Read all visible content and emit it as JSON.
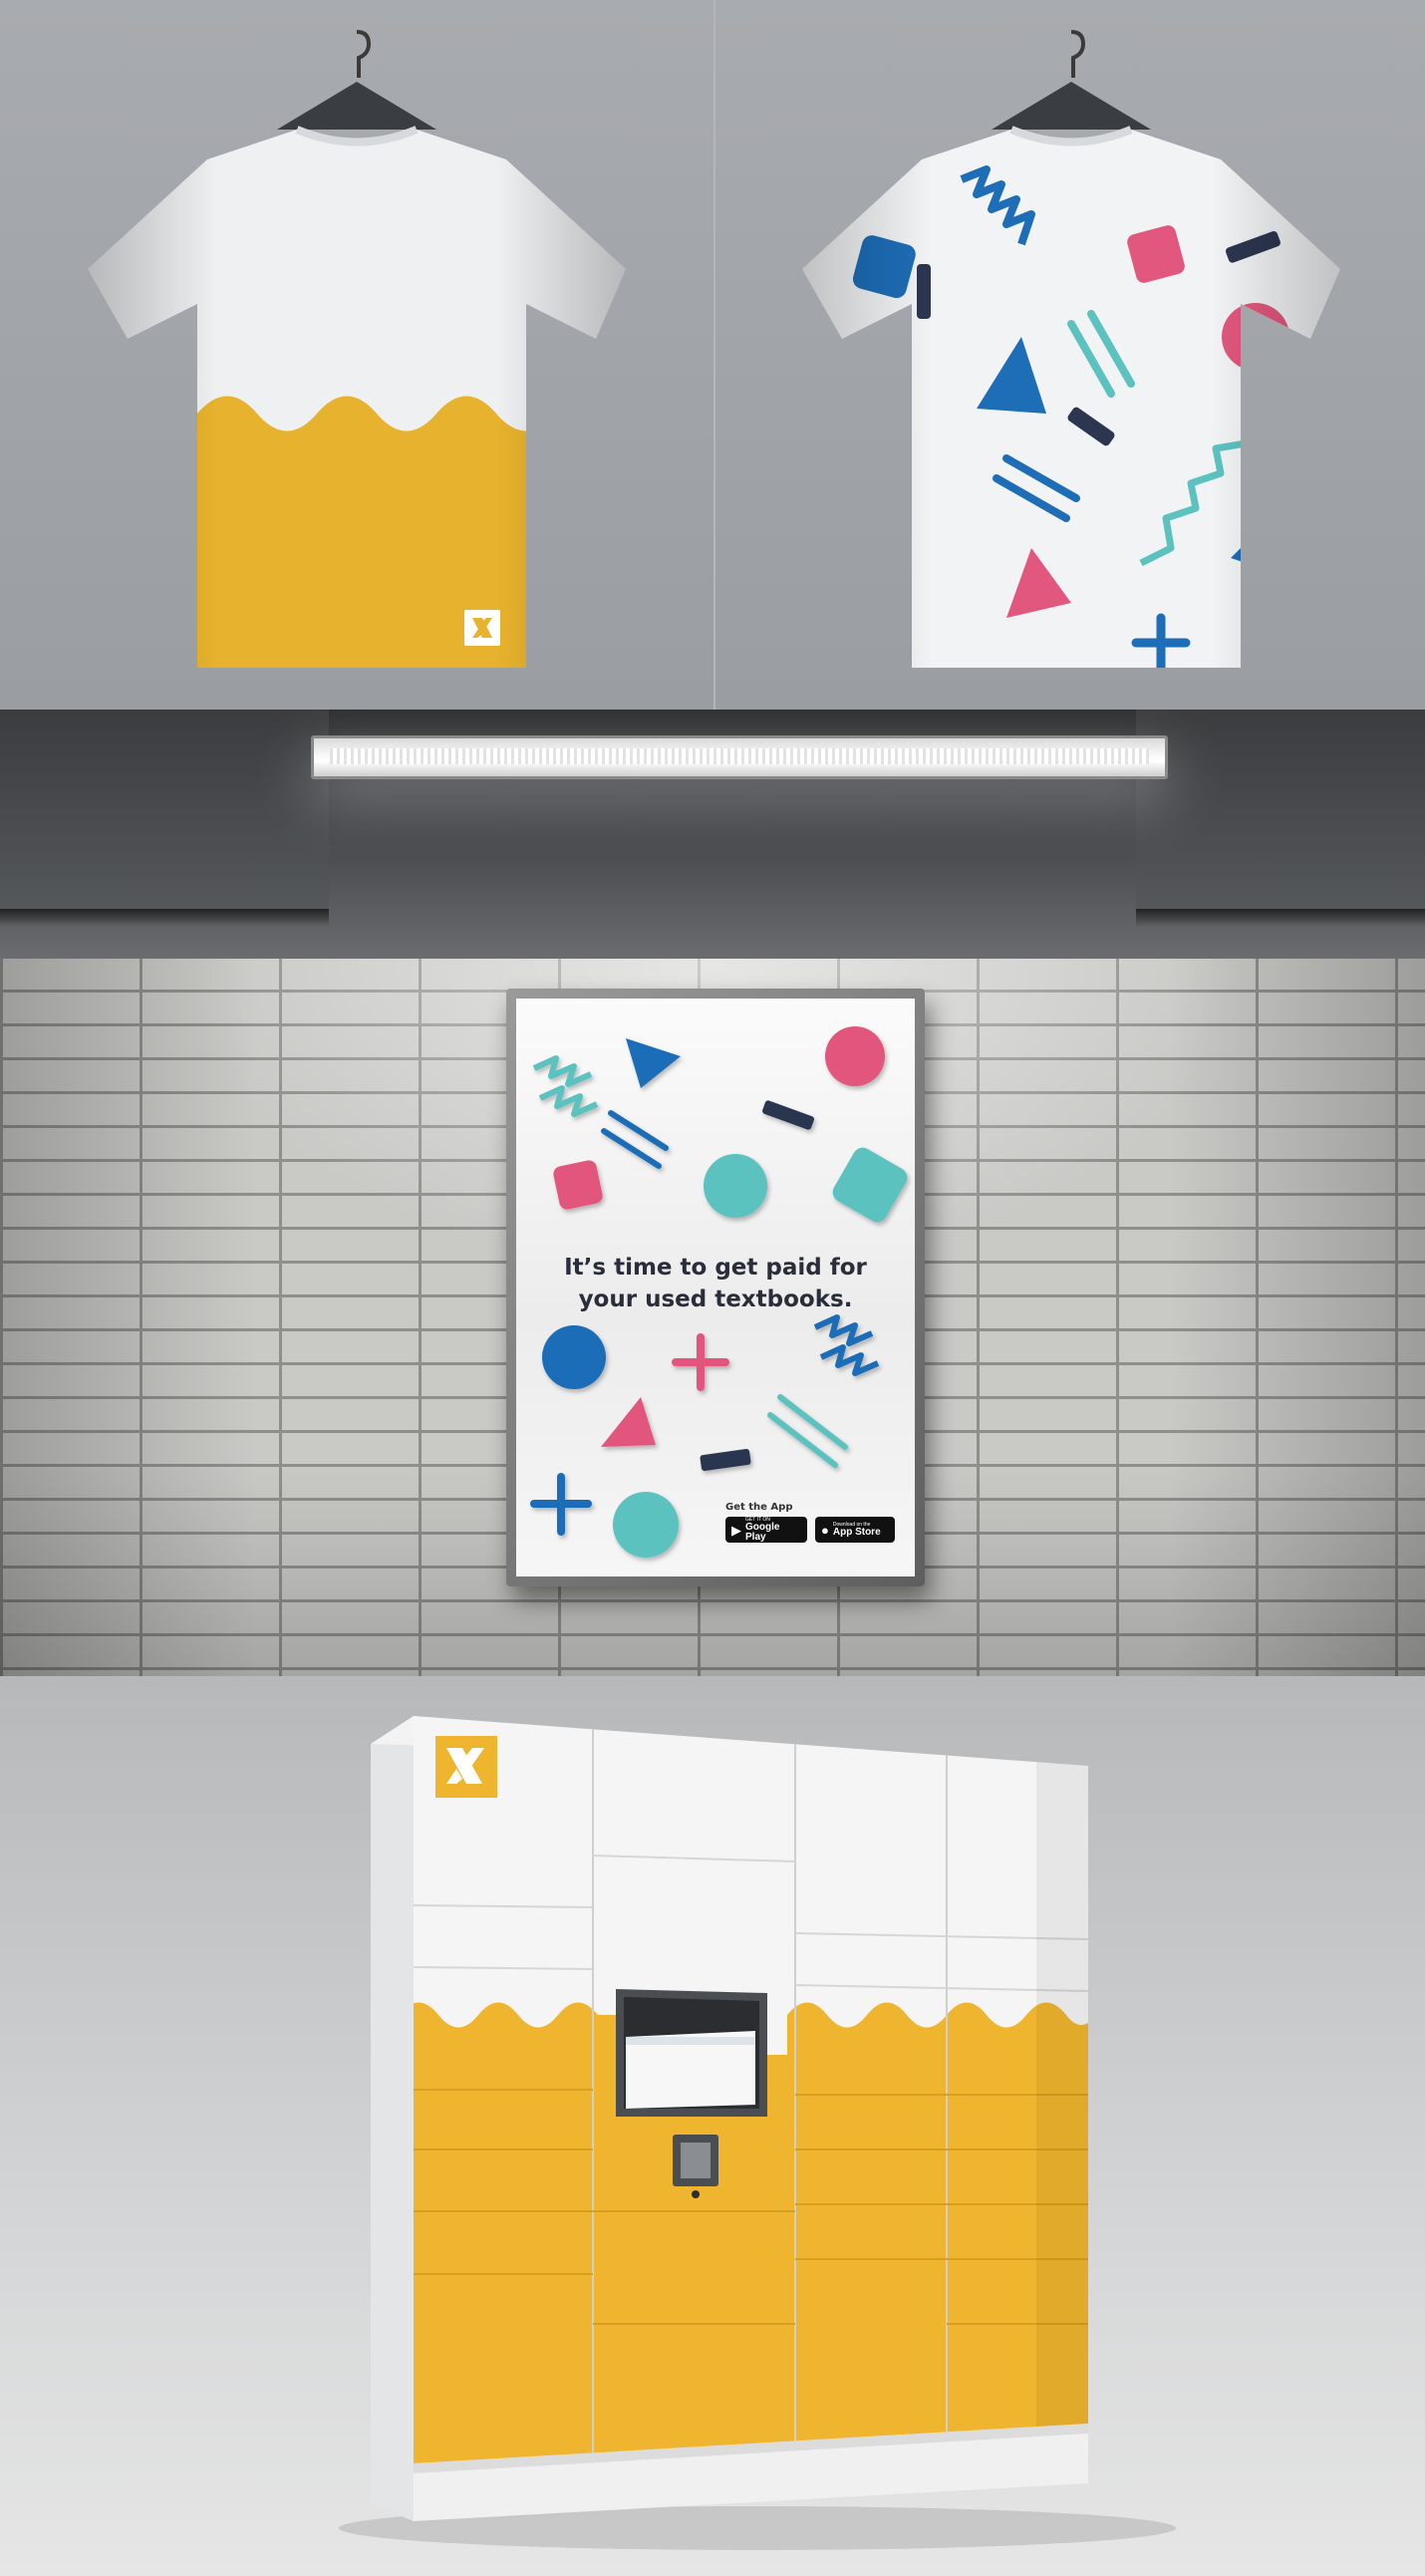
{
  "poster": {
    "headline_line1": "It’s time to get paid for",
    "headline_line2": "your used textbooks.",
    "get_app": "Get the App",
    "google_play": {
      "small": "GET IT ON",
      "big": "Google Play"
    },
    "app_store": {
      "small": "Download on the",
      "big": "App Store"
    }
  },
  "brand": {
    "logo_icon": "x-logo-icon",
    "yellow": "#F0B52E",
    "blue": "#1D6DB7",
    "teal": "#5BC2C0",
    "pink": "#E2577D",
    "navy": "#2C3650"
  }
}
